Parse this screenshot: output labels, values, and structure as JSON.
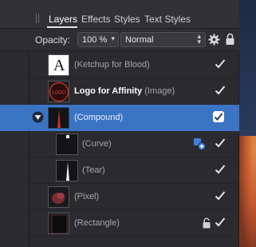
{
  "tabs": [
    {
      "label": "Layers",
      "active": true
    },
    {
      "label": "Effects",
      "active": false
    },
    {
      "label": "Styles",
      "active": false
    },
    {
      "label": "Text Styles",
      "active": false
    }
  ],
  "opacity": {
    "label": "Opacity:",
    "value": "100 %",
    "blend_mode": "Normal"
  },
  "layers": [
    {
      "name": "",
      "type": "(Ketchup for Blood)",
      "visible": true,
      "thumb": "letter-A",
      "thumb_letter": "A"
    },
    {
      "name": "Logo for Affinity",
      "type": "(Image)",
      "visible": true,
      "thumb": "logo",
      "thumb_text": "LOGO"
    },
    {
      "name": "",
      "type": "(Compound)",
      "visible": true,
      "selected": true,
      "expanded": true,
      "thumb": "compound"
    },
    {
      "name": "",
      "type": "(Curve)",
      "visible": true,
      "child": true,
      "badge": "add-shape-icon",
      "thumb": "curve"
    },
    {
      "name": "",
      "type": "(Tear)",
      "visible": true,
      "child": true,
      "thumb": "tear"
    },
    {
      "name": "",
      "type": "(Pixel)",
      "visible": true,
      "thumb": "pixel"
    },
    {
      "name": "",
      "type": "(Rectangle)",
      "visible": true,
      "locked": true,
      "thumb": "rectangle"
    }
  ],
  "colors": {
    "selection": "#3c74c4",
    "panel": "#2b2b2f"
  }
}
